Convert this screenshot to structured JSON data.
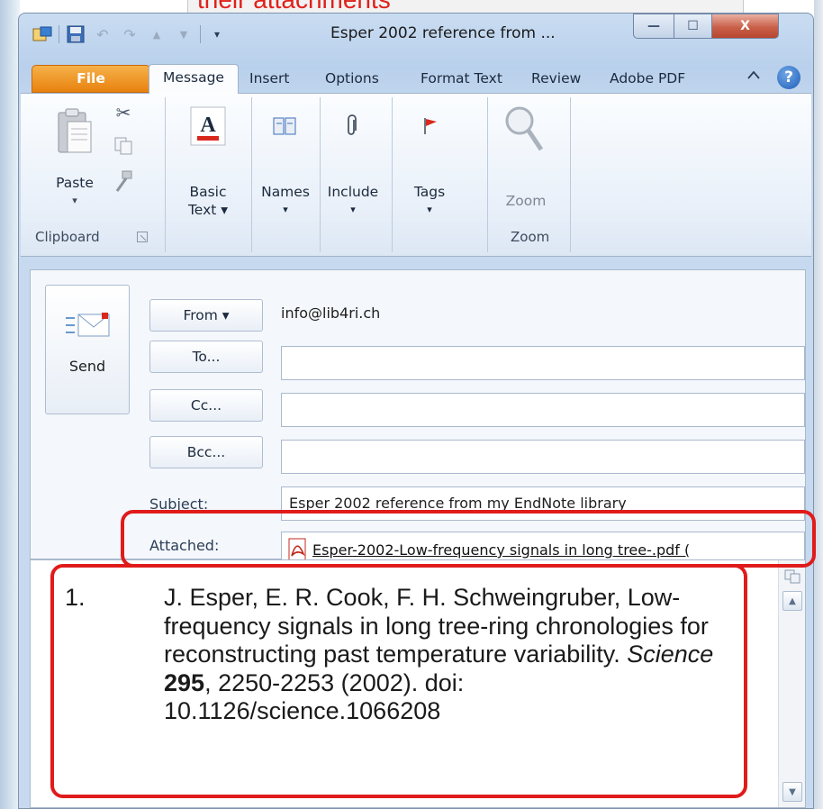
{
  "caption": {
    "text": "their attachments"
  },
  "window": {
    "title": "Esper 2002 reference from ...",
    "controls": {
      "minimize": "—",
      "maximize": "☐",
      "close": "X"
    }
  },
  "tabs": [
    "File",
    "Message",
    "Insert",
    "Options",
    "Format Text",
    "Review",
    "Adobe PDF"
  ],
  "ribbon": {
    "paste": "Paste",
    "basic_text": {
      "line1": "Basic",
      "line2": "Text ▾"
    },
    "names": "Names",
    "include": "Include",
    "tags": "Tags",
    "zoom": "Zoom",
    "groups": {
      "clipboard": "Clipboard",
      "zoom": "Zoom"
    }
  },
  "compose": {
    "send_label": "Send",
    "from_label": "From ▾",
    "from_value": "info@lib4ri.ch",
    "to_label": "To...",
    "cc_label": "Cc...",
    "bcc_label": "Bcc...",
    "subject_label": "Subject:",
    "subject_value": "Esper 2002 reference from my EndNote library",
    "attached_label": "Attached:",
    "attachment_name": "Esper-2002-Low-frequency signals in long tree-.pdf ("
  },
  "body": {
    "number": "1.",
    "authors": "J. Esper, E. R. Cook, F. H. Schweingruber, Low-frequency signals in long tree-ring chronologies for reconstructing past temperature variability.",
    "journal": "Science",
    "volume": "295",
    "rest": ", 2250-2253 (2002). doi: 10.1126/science.1066208"
  },
  "colors": {
    "highlight": "#e01b1b",
    "file_tab": "#e8820e"
  }
}
